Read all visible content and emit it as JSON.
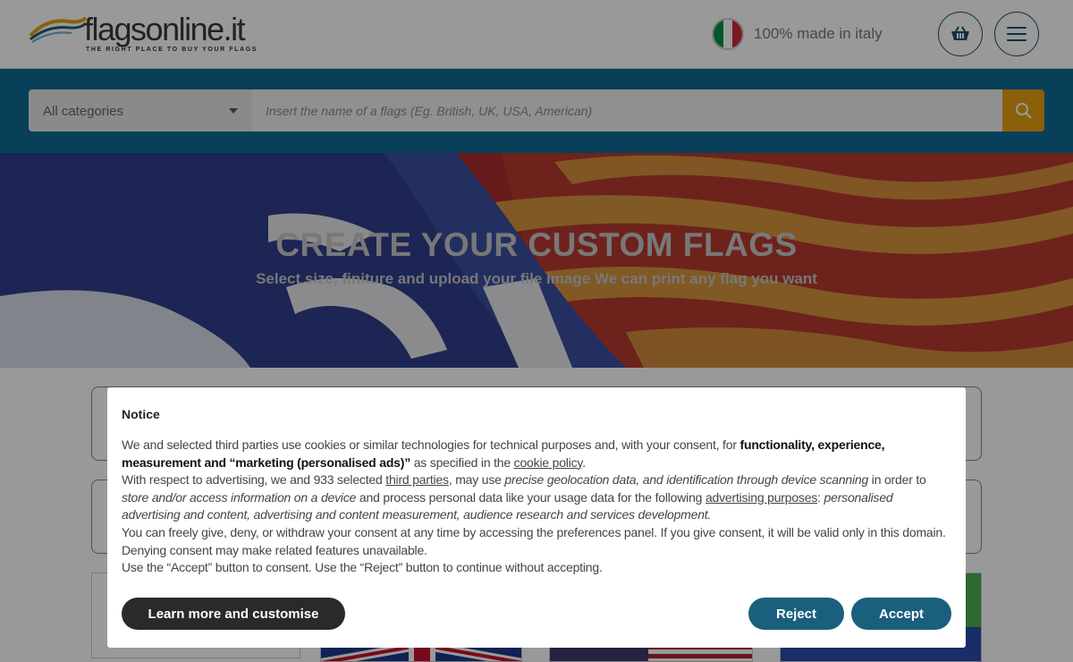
{
  "header": {
    "logo_text": "flagsonline.it",
    "logo_tagline": "THE RIGHT PLACE TO BUY YOUR FLAGS",
    "made_in": "100% made in italy",
    "flag_colors": [
      "#009246",
      "#ffffff",
      "#ce2b37"
    ]
  },
  "search": {
    "category_selected": "All categories",
    "placeholder": "Insert the name of a flags (Eg. British, UK, USA, American)",
    "button_icon": "search-icon"
  },
  "hero": {
    "title": "CREATE YOUR CUSTOM FLAGS",
    "subtitle": "Select size, finiture and upload your file image We can print any flag you want"
  },
  "notice": {
    "title": "Notice",
    "p1_a": "We and selected third parties use cookies or similar technologies for technical purposes and, with your consent, for ",
    "p1_bold": "functionality, experience, measurement and “marketing (personalised ads)”",
    "p1_b": " as specified in the ",
    "p1_link": "cookie policy",
    "p1_c": ".",
    "p2_a": "With respect to advertising, we and 933 selected ",
    "p2_link1": "third parties",
    "p2_b": ", may use ",
    "p2_i1": "precise geolocation data, and identification through device scanning",
    "p2_c": " in order to ",
    "p2_i2": "store and/or access information on a device",
    "p2_d": " and process personal data like your usage data for the following ",
    "p2_link2": "advertising purposes",
    "p2_e": ": ",
    "p2_i3": "personalised advertising and content, advertising and content measurement, audience research and services development.",
    "p3": "You can freely give, deny, or withdraw your consent at any time by accessing the preferences panel. If you give consent, it will be valid only in this domain. Denying consent may make related features unavailable.",
    "p4": "Use the “Accept” button to consent. Use the “Reject” button to continue without accepting.",
    "learn_more": "Learn more and customise",
    "reject": "Reject",
    "accept": "Accept"
  },
  "colors": {
    "primary_blue": "#0f6b94",
    "search_button": "#e6a011",
    "button_dark": "#2a2a2a",
    "button_teal": "#1a5f7e"
  }
}
